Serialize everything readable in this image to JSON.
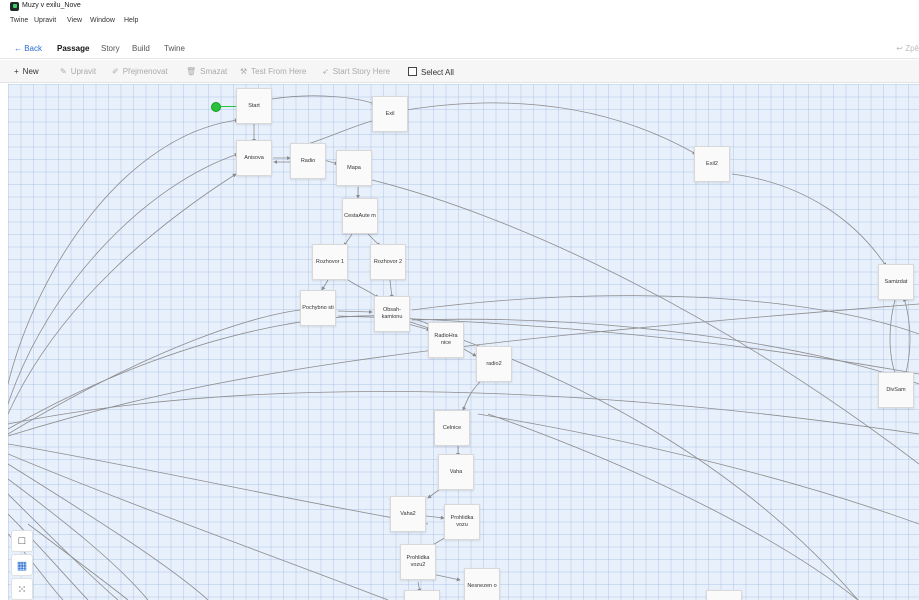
{
  "window": {
    "title": "Muzy v exilu_Nove"
  },
  "menu": [
    "Twine",
    "Upravit",
    "View",
    "Window",
    "Help"
  ],
  "nav": {
    "back": "← Back",
    "tabs": [
      "Passage",
      "Story",
      "Build",
      "Twine"
    ],
    "right": "↩ Zpě"
  },
  "toolbar": {
    "new": "New",
    "edit": "Upravit",
    "rename": "Přejmenovat",
    "delete": "Smazat",
    "test": "Test From Here",
    "start": "Start Story Here",
    "select_all": "Select All"
  },
  "passages": [
    {
      "id": "start",
      "label": "Start"
    },
    {
      "id": "exil",
      "label": "Exil"
    },
    {
      "id": "anisova",
      "label": "Anisova"
    },
    {
      "id": "radio",
      "label": "Radio"
    },
    {
      "id": "mapa",
      "label": "Mapa"
    },
    {
      "id": "exil2",
      "label": "Exil2"
    },
    {
      "id": "cestaautem",
      "label": "CestaAute m"
    },
    {
      "id": "rozhovor1",
      "label": "Rozhovor 1"
    },
    {
      "id": "rozhovor2",
      "label": "Rozhovor 2"
    },
    {
      "id": "samizdat",
      "label": "Samizdat"
    },
    {
      "id": "pochybnosti",
      "label": "Pochybno sti"
    },
    {
      "id": "obsahkamionu",
      "label": "Obsah-kamionu"
    },
    {
      "id": "radiohranice",
      "label": "RadioHra nice"
    },
    {
      "id": "radio2",
      "label": "radio2"
    },
    {
      "id": "divsam",
      "label": "DivSam"
    },
    {
      "id": "celnice",
      "label": "Celnice"
    },
    {
      "id": "vaha",
      "label": "Vaha"
    },
    {
      "id": "vaha2",
      "label": "Vaha2"
    },
    {
      "id": "prohlidkavozu",
      "label": "Prohlidka vozu"
    },
    {
      "id": "prohlidkavozu2",
      "label": "Prohlidka vozu2"
    },
    {
      "id": "nesnezeno",
      "label": "Nesnezen o"
    },
    {
      "id": "bottom1",
      "label": ""
    },
    {
      "id": "bottom2",
      "label": ""
    }
  ]
}
